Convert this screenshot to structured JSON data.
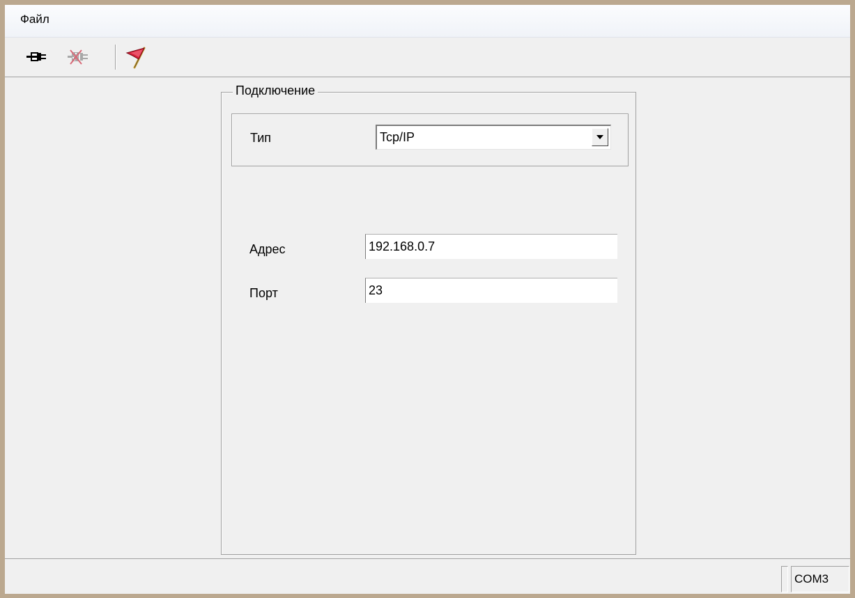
{
  "menu": {
    "file": "Файл"
  },
  "toolbar": {
    "connect_icon": "plug-connect-icon",
    "disconnect_icon": "plug-disconnect-icon",
    "flag_icon": "red-flag-icon"
  },
  "connection": {
    "group_title": "Подключение",
    "type_label": "Тип",
    "type_value": "Tcp/IP",
    "address_label": "Адрес",
    "address_value": "192.168.0.7",
    "port_label": "Порт",
    "port_value": "23"
  },
  "status": {
    "port": "COM3"
  },
  "colors": {
    "window_frame": "#bba88f",
    "background": "#f0f0f0",
    "flag_red": "#d8203a"
  }
}
